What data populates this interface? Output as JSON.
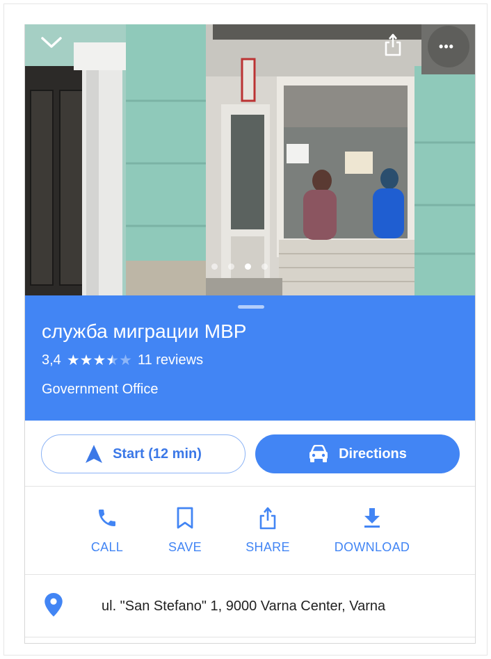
{
  "place": {
    "title": "служба миграции МВР",
    "rating": "3,4",
    "rating_value": 3.4,
    "stars_max": 5,
    "reviews": "11 reviews",
    "category": "Government Office"
  },
  "photo": {
    "dots_count": 4,
    "active_dot": 2,
    "more_label": "•••"
  },
  "actions": {
    "start_label": "Start (12 min)",
    "directions_label": "Directions"
  },
  "quick_actions": [
    {
      "label": "CALL",
      "icon": "phone-icon"
    },
    {
      "label": "SAVE",
      "icon": "bookmark-icon"
    },
    {
      "label": "SHARE",
      "icon": "share-icon"
    },
    {
      "label": "DOWNLOAD",
      "icon": "download-icon"
    }
  ],
  "address": {
    "text": "ul. \"San Stefano\" 1, 9000 Varna Center, Varna",
    "icon": "location-pin-icon"
  },
  "colors": {
    "accent": "#4285f4",
    "text": "#212121"
  }
}
